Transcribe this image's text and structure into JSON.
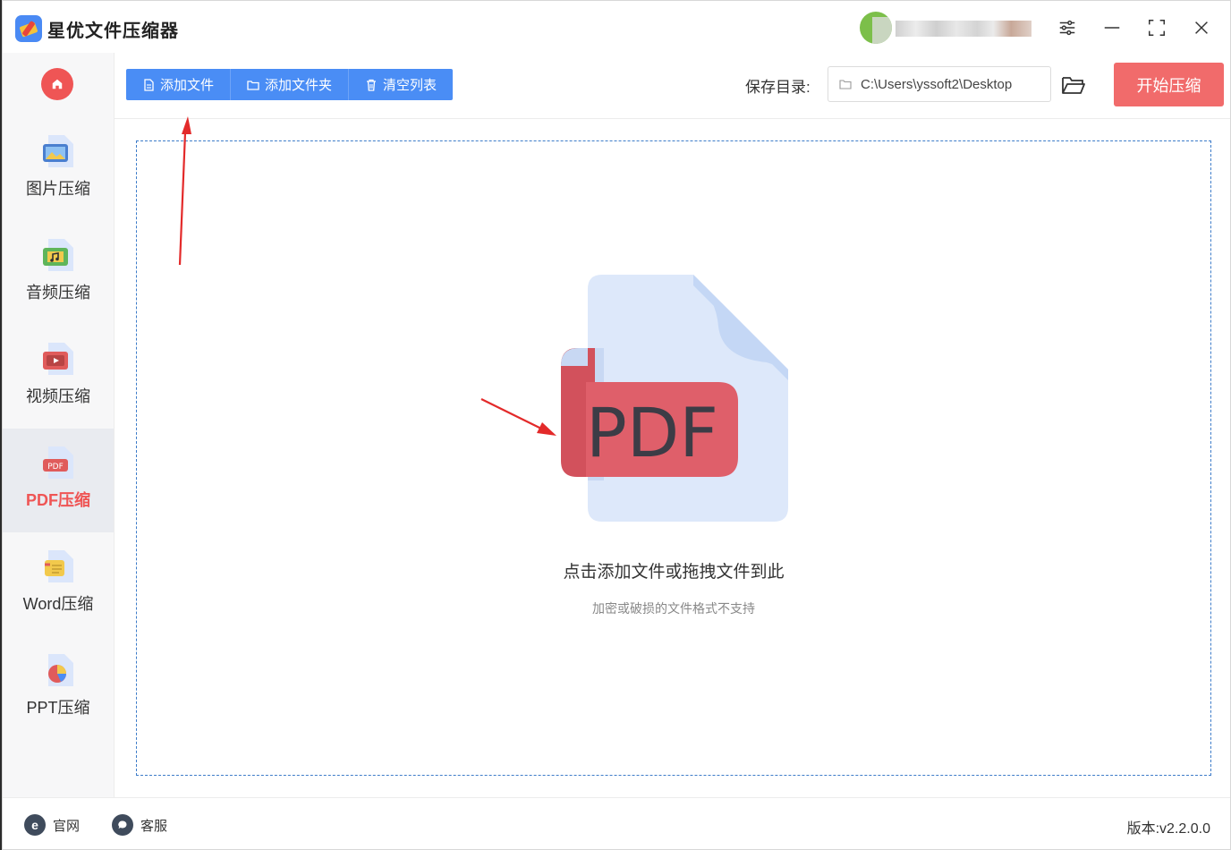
{
  "app": {
    "title": "星优文件压缩器"
  },
  "sidebar": {
    "items": [
      {
        "label": "图片压缩",
        "icon": "image-icon"
      },
      {
        "label": "音频压缩",
        "icon": "audio-icon"
      },
      {
        "label": "视频压缩",
        "icon": "video-icon"
      },
      {
        "label": "PDF压缩",
        "icon": "pdf-icon",
        "active": true
      },
      {
        "label": "Word压缩",
        "icon": "word-icon"
      },
      {
        "label": "PPT压缩",
        "icon": "ppt-icon"
      }
    ]
  },
  "toolbar": {
    "add_file": "添加文件",
    "add_folder": "添加文件夹",
    "clear_list": "清空列表",
    "save_dir_label": "保存目录:",
    "save_path": "C:\\Users\\yssoft2\\Desktop",
    "start": "开始压缩"
  },
  "dropzone": {
    "pdf_badge": "PDF",
    "main_text": "点击添加文件或拖拽文件到此",
    "sub_text": "加密或破损的文件格式不支持"
  },
  "footer": {
    "website": "官网",
    "support": "客服",
    "version": "版本:v2.2.0.0"
  },
  "colors": {
    "accent_blue": "#4a8df5",
    "accent_red": "#f16b6b",
    "pdf_red": "#df5f6a",
    "dropzone_border": "#3d7cc9"
  }
}
